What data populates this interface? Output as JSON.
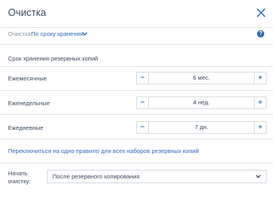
{
  "dialog": {
    "title": "Очистка"
  },
  "breadcrumb": {
    "root": "Очистка",
    "current": "По сроку хранения"
  },
  "retention": {
    "section_title": "Срок хранения резервных копий",
    "rows": [
      {
        "label": "Ежемесячные",
        "value": "6 мес."
      },
      {
        "label": "Еженедельные",
        "value": "4 нед."
      },
      {
        "label": "Ежедневные",
        "value": "7 дн."
      }
    ],
    "minus_symbol": "−",
    "plus_symbol": "+"
  },
  "switch_link": "Переключиться на одно правило для всех наборов резервных копий",
  "start_cleanup": {
    "label": "Начать очистку:",
    "selected": "После резервного копирования"
  },
  "colors": {
    "accent": "#2b6cc4",
    "help": "#2e64b3",
    "divider": "#dfe5ec"
  }
}
